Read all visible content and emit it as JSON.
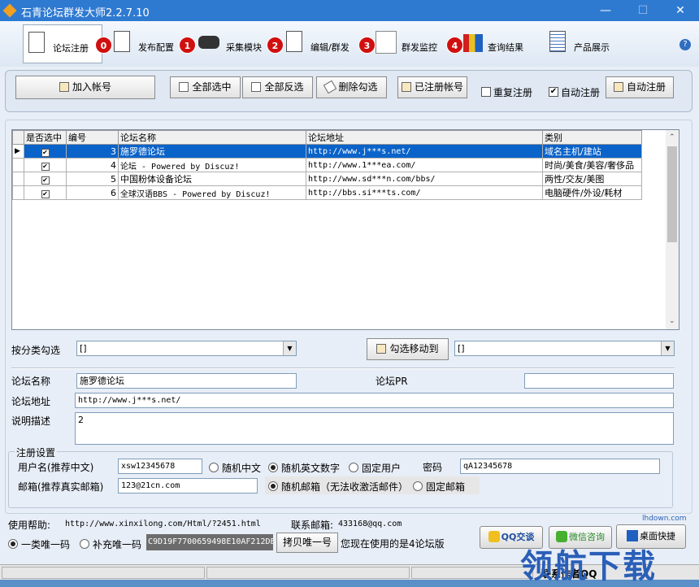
{
  "window": {
    "title": "石青论坛群发大师2.2.7.10"
  },
  "nav": {
    "tabs": [
      {
        "label": "论坛注册",
        "badge": "0"
      },
      {
        "label": "发布配置",
        "badge": "1"
      },
      {
        "label": "采集模块",
        "badge": "2"
      },
      {
        "label": "编辑/群发",
        "badge": "3"
      },
      {
        "label": "群发监控",
        "badge": "4"
      },
      {
        "label": "查询结果"
      },
      {
        "label": "产品展示"
      }
    ],
    "help": "?"
  },
  "toolbar": {
    "add_account": "加入帐号",
    "select_all": "全部选中",
    "invert_select": "全部反选",
    "delete_checked": "删除勾选",
    "registered_accounts": "已注册帐号",
    "repeat_register": "重复注册",
    "auto_register_check": "自动注册",
    "auto_register_btn": "自动注册"
  },
  "grid": {
    "headers": [
      "是否选中",
      "编号",
      "论坛名称",
      "论坛地址",
      "类别"
    ],
    "rows": [
      {
        "checked": "✔",
        "id": "3",
        "name": "施罗德论坛",
        "url": "http://www.j***s.net/",
        "category": "域名主机/建站"
      },
      {
        "checked": "✔",
        "id": "4",
        "name": "论坛 -  Powered by Discuz!",
        "url": "http://www.1***ea.com/",
        "category": "时尚/美食/美容/奢侈品"
      },
      {
        "checked": "✔",
        "id": "5",
        "name": "中国粉体设备论坛",
        "url": "http://www.sd***n.com/bbs/",
        "category": "两性/交友/美图"
      },
      {
        "checked": "✔",
        "id": "6",
        "name": " 全球汉语BBS  - Powered by Discuz!",
        "url": "http://bbs.si***ts.com/",
        "category": "电脑硬件/外设/耗材"
      }
    ]
  },
  "classify": {
    "label": "按分类勾选",
    "combo_value": "[]",
    "move_btn": "勾选移动到",
    "target_value": "[]"
  },
  "detail": {
    "name_label": "论坛名称",
    "name_value": "施罗德论坛",
    "pr_label": "论坛PR",
    "pr_value": "",
    "url_label": "论坛地址",
    "url_value": "http://www.j***s.net/",
    "desc_label": "说明描述",
    "desc_value": "2"
  },
  "reg": {
    "group_title": "注册设置",
    "user_label": "用户名(推荐中文)",
    "user_value": "xsw12345678",
    "opt_random_cn": "随机中文",
    "opt_random_en": "随机英文数字",
    "opt_fixed_user": "固定用户",
    "pwd_label": "密码",
    "pwd_value": "qA12345678",
    "mail_label": "邮箱(推荐真实邮箱)",
    "mail_value": "123@21cn.com",
    "opt_random_mail": "随机邮箱（无法收激活邮件）",
    "opt_fixed_mail": "固定邮箱"
  },
  "footer": {
    "help_label": "使用帮助:",
    "help_url": "http://www.xinxilong.com/Html/?2451.html",
    "contact_label": "联系邮箱:",
    "contact_value": "433168@qq.com",
    "opt_class_one": "一类唯一码",
    "opt_supplement": "补充唯一码",
    "uid": "C9D19F7700659498E10AF212DE",
    "copy_btn": "拷贝唯一号",
    "forum_count_text": "您现在使用的是4论坛版",
    "qq_btn": "QQ交谈",
    "wechat_btn": "微信咨询",
    "desktop_btn": "桌面快捷"
  },
  "status": {
    "contact_qq": "联系作者QQ"
  },
  "watermark": {
    "text": "领航下载",
    "small": "lhdown.com"
  }
}
